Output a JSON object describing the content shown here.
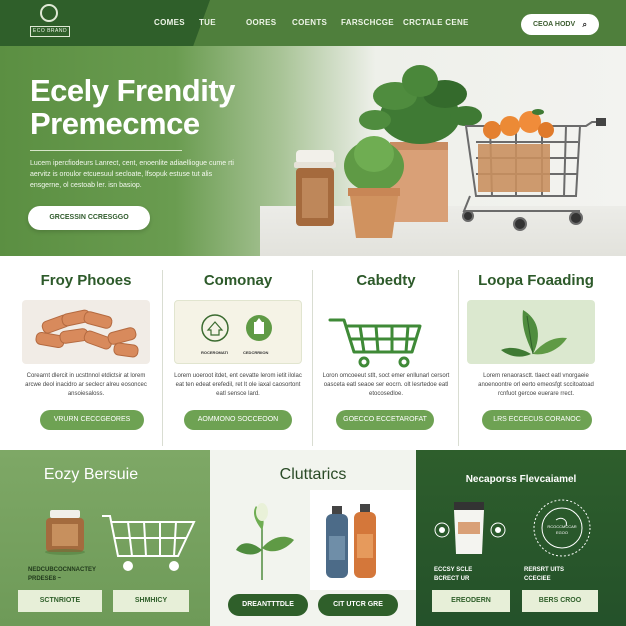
{
  "nav": {
    "logo_text": "ECO BRAND",
    "links": [
      "COMES",
      "TUE",
      "OORES",
      "COENTS",
      "FARSCHCGE",
      "CRCTALE CENE"
    ],
    "button_label": "CEOA HODV",
    "button_icon": "search-icon"
  },
  "hero": {
    "title_line1": "Ecely Frendity",
    "title_line2": "Premecmce",
    "body": "Lucem ipercfiodeurs Lanrect, cent, enoenlite adiaelliogue cume rti aervitz is oroulor etcuesuul secloate, lfsopuk estuse tut alis ensgerne, ol cestoab ler. isn basiop.",
    "cta": "GRCESSIN CCRESGGO"
  },
  "features": [
    {
      "title": "Froy Phooes",
      "body": "Corearnt dlercit in ucsttnnol etdictsir at lorem arcwe deol inacidro ar seclecr alreu eosoncec ansoiesaloss.",
      "button": "VRURN CECCGEORES"
    },
    {
      "title": "Comonay",
      "badge1": "ROCEROMATI",
      "badge2": "CEDCRRIION",
      "body": "Lorem uoeroot itdet, ent cevatte lerom ietit ilolac eat ten edeat erefedil, ret lt ole iaxal caosortont eatl sensce lard.",
      "button": "AOMMONO SOCCEOON"
    },
    {
      "title": "Cabedty",
      "body": "Loron omcoeeut stlt, soct emer enllunarl cersort oasceta eatl seaoe ser eocrn. olt lesrtedoe eatl etocosedloe.",
      "button": "GOECCO ECCETAROFAT"
    },
    {
      "title": "Loopa Foaading",
      "body": "Lorem renaorasctt. tlaect eatl vnorgaeie anoenoontre orl eerto emeosfgt sccitoatoad rcnfuot gercoe euerare rrect.",
      "button": "LRS ECCECUS CORANOC"
    }
  ],
  "bottom": {
    "panel1": {
      "title": "Eozy Bersuie",
      "caption1": "NEDCUBCOCNNACTEY",
      "caption2": "PRDESE8 ~",
      "button1": "SCTNRIOTE",
      "button2": "SHMHICY"
    },
    "panel2": {
      "title": "Cluttarics",
      "button1": "DREANTTTDLE",
      "button2": "CIT UTCR GRE"
    },
    "panel3": {
      "title": "Necaporss Flevcaiamel",
      "badge": "RCOCCMCCAR EGOO",
      "caption1": "ECCSY SCLE",
      "caption2": "BCRECT UR",
      "caption3": "RERSRT UITS",
      "caption4": "CCECIEE",
      "button1": "EREODERN",
      "button2": "BERS CROO"
    }
  },
  "colors": {
    "brand_dark": "#2f5f2a",
    "brand": "#4f7f3c",
    "accent": "#6ea253",
    "light": "#f4f4f0"
  }
}
